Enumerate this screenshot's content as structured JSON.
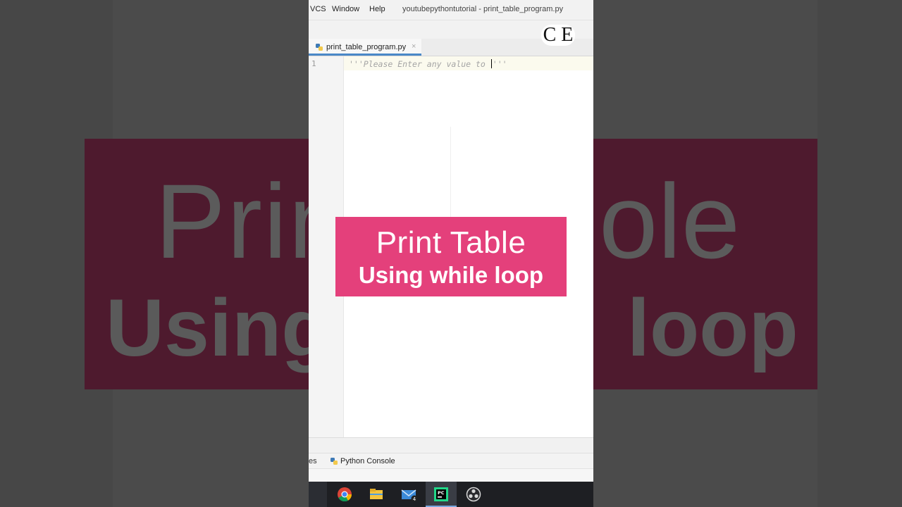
{
  "menu": {
    "items": [
      "VCS",
      "Window",
      "Help"
    ],
    "window_title": "youtubepythontutorial - print_table_program.py"
  },
  "watermark": {
    "logo_text": "C E"
  },
  "editor": {
    "tab_label": "print_table_program.py",
    "tab_close": "×",
    "line_number": "1",
    "code_before_caret": "'''Please Enter any value to ",
    "code_after_caret": "'''"
  },
  "tool_windows": {
    "cut_label": "es",
    "python_console": "Python Console"
  },
  "overlay": {
    "line1": "Print Table",
    "line2": "Using while loop"
  },
  "background_text": {
    "line1_left": "Print",
    "line1_right": "ole",
    "line2_left": "Using",
    "line2_right": "loop"
  },
  "taskbar": {
    "apps": [
      "chrome-icon",
      "file-explorer-icon",
      "mail-icon",
      "pycharm-icon",
      "obs-icon"
    ],
    "mail_badge": "4",
    "active_app": "pycharm-icon"
  },
  "colors": {
    "card_pink": "#e4407b",
    "tab_underline": "#4a88c7",
    "taskbar": "#1e1f23"
  }
}
